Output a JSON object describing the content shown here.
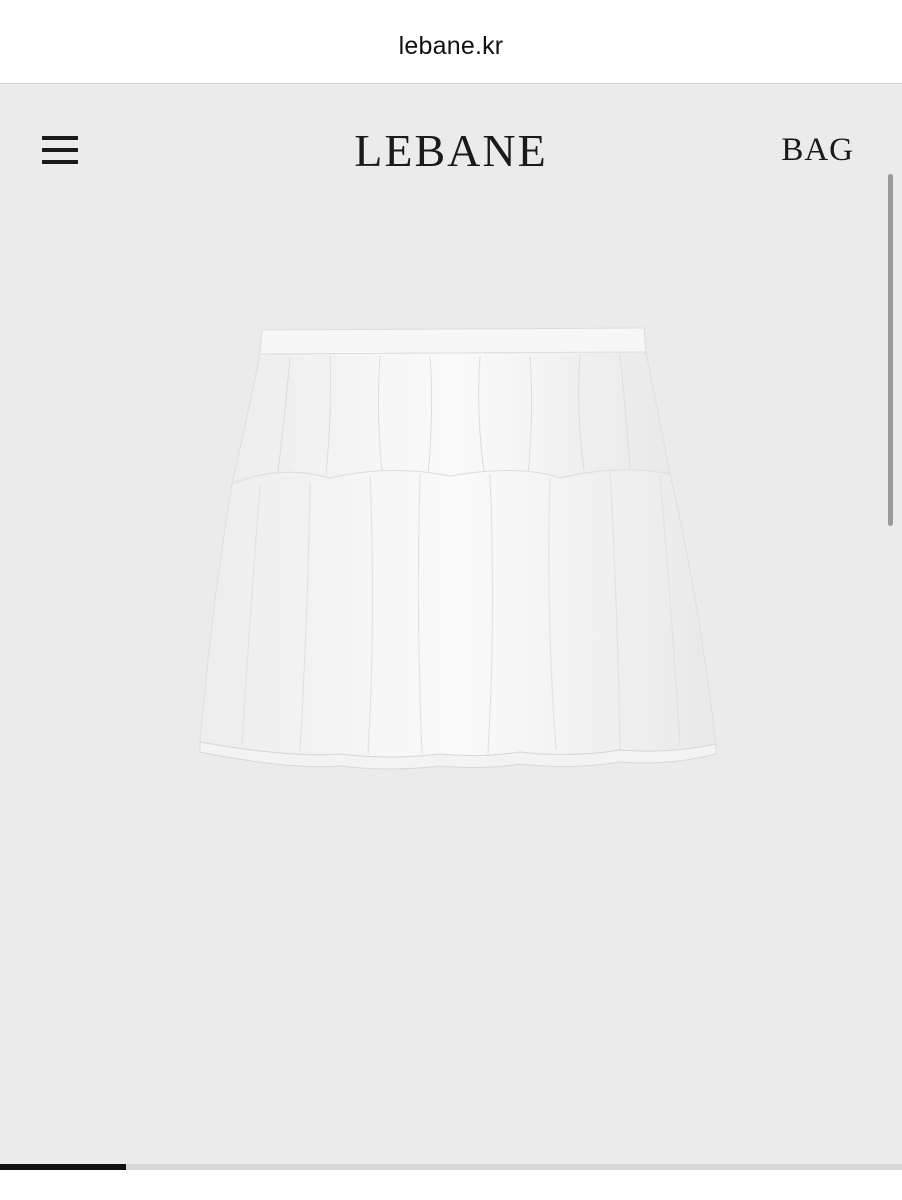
{
  "browser": {
    "url": "lebane.kr"
  },
  "header": {
    "menu_icon": "hamburger-menu-icon",
    "brand": "LEBANE",
    "bag_label": "BAG"
  },
  "product": {
    "image_icon": "white-tiered-mini-skirt"
  },
  "gallery": {
    "progress": 0.14
  },
  "colors": {
    "page_background": "#ebebeb",
    "text": "#1a1a1a",
    "progress_fill": "#111111",
    "progress_track": "#d9d9d9"
  }
}
